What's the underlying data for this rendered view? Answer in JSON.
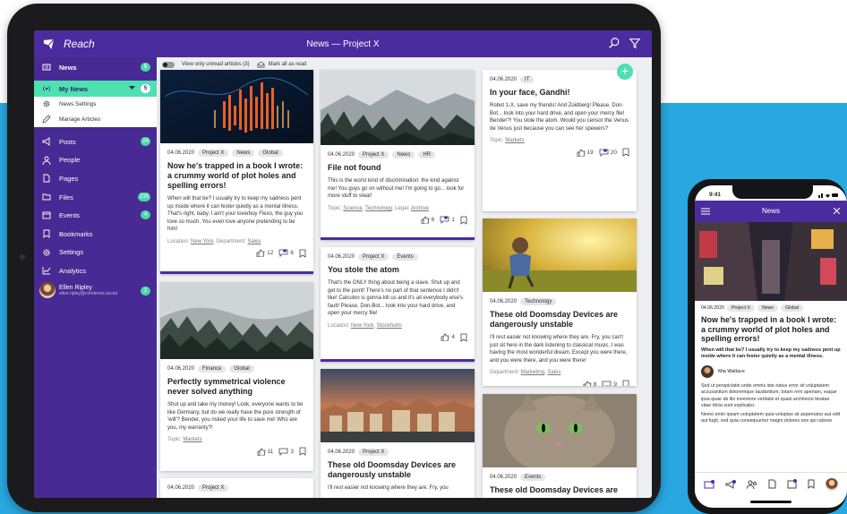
{
  "tablet": {
    "app_name": "Reach",
    "page_title": "News — Project X",
    "filter": {
      "unread_label": "View only unread articles (3)",
      "mark_read_label": "Mark all as read"
    },
    "sidebar": {
      "news": {
        "label": "News",
        "badge": "5"
      },
      "my_news": {
        "label": "My News",
        "badge": "5"
      },
      "submenu": [
        "News Settings",
        "Manage Articles"
      ],
      "items": [
        {
          "label": "Posts",
          "badge": "24",
          "icon": "megaphone-icon"
        },
        {
          "label": "People",
          "badge": "",
          "icon": "person-icon"
        },
        {
          "label": "Pages",
          "badge": "",
          "icon": "page-icon"
        },
        {
          "label": "Files",
          "badge": "235",
          "icon": "folder-icon"
        },
        {
          "label": "Events",
          "badge": "4",
          "icon": "calendar-icon"
        },
        {
          "label": "Bookmarks",
          "badge": "",
          "icon": "bookmark-icon"
        },
        {
          "label": "Settings",
          "badge": "",
          "icon": "gear-icon"
        },
        {
          "label": "Analytics",
          "badge": "",
          "icon": "chart-icon"
        }
      ],
      "user": {
        "name": "Ellen Ripley",
        "email": "ellen.ripley@condense.social",
        "badge": "2"
      }
    },
    "cards": {
      "c1": {
        "date": "04.06.2020",
        "tags": [
          "Project X",
          "News",
          "Global"
        ],
        "title": "Now he's trapped in a book I wrote: a crummy world of plot holes and spelling errors!",
        "desc": "When will that be? I usually try to keep my sadness pent up inside where it can fester quietly as a mental illness. That's right, baby. I ain't your loverboy Flexo, the guy you love so much. You even love anyone pretending to be him!",
        "foot_prefix": "Location: ",
        "foot_link1": "New York",
        "foot_mid": ", Department: ",
        "foot_link2": "Sales",
        "likes": "12",
        "comments": "6"
      },
      "c2": {
        "date": "04.06.2020",
        "tags": [
          "Finance",
          "Global"
        ],
        "title": "Perfectly symmetrical violence never solved anything",
        "desc": "Shut up and take my money! Look, everyone wants to be like Germany, but do we really have the pure strength of 'will'? Bender, you risked your life to save me! Who are you, my warranty?!",
        "foot_prefix": "Topic: ",
        "foot_link1": "Markets",
        "likes": "11",
        "comments": "3"
      },
      "c3": {
        "date": "04.06.2020",
        "tags": [
          "Project X"
        ]
      },
      "c4": {
        "date": "04.06.2020",
        "tags": [
          "Project X",
          "News",
          "HR"
        ],
        "title": "File not found",
        "desc": "This is the worst kind of discrimination: the kind against me! You guys go on without me! I'm going to go... look for more stuff to steal!",
        "foot_prefix": "Topic: ",
        "foot_link1": "Science",
        "foot_sep": ", ",
        "foot_link2": "Technology",
        "foot_mid": ", Legal: ",
        "foot_link3": "Archive",
        "likes": "6",
        "comments": "1"
      },
      "c5": {
        "date": "04.06.2020",
        "tags": [
          "Project X",
          "Events"
        ],
        "title": "You stole the atom",
        "desc": "That's the ONLY thing about being a slave. Shut up and get to the point! There's no part of that sentence I didn't like! Calculon is gonna kill us and it's all everybody else's fault! Please, Don-Bot... look into your hard drive, and open your mercy file!",
        "foot_prefix": "Location: ",
        "foot_link1": "New York",
        "foot_sep": ", ",
        "foot_link2": "Stockholm",
        "likes": "4"
      },
      "c6": {
        "date": "04.06.2020",
        "tags": [
          "Project X"
        ],
        "title": "These old Doomsday Devices are dangerously unstable",
        "desc": "I'll rest easier not knowing where they are. Fry, you"
      },
      "c7": {
        "date": "04.06.2020",
        "tags": [
          "IT"
        ],
        "title": "In your face, Gandhi!",
        "desc": "Robot 1-X, save my friends! And Zoidberg! Please, Don-Bot... look into your hard drive, and open your mercy file! Bender?! You stole the atom. Would you censor the Venus de Venus just because you can see her spewers?",
        "foot_prefix": "Topic: ",
        "foot_link1": "Markets",
        "likes": "19",
        "comments": "20"
      },
      "c8": {
        "date": "04.06.2020",
        "tags": [
          "Technology"
        ],
        "title": "These old Doomsday Devices are dangerously unstable",
        "desc": "I'll rest easier not knowing where they are. Fry, you can't just sit here in the dark listening to classical music. I was having the most wonderful dream. Except you were there, and you were there, and you were there!",
        "foot_prefix": "Department: ",
        "foot_link1": "Marketing",
        "foot_sep": ", ",
        "foot_link2": "Sales",
        "likes": "8",
        "comments": "9"
      },
      "c9": {
        "date": "04.06.2020",
        "tags": [
          "Events"
        ],
        "title": "These old Doomsday Devices are"
      }
    }
  },
  "phone": {
    "time": "9:41",
    "title": "News",
    "date": "04.06.2020",
    "tags": [
      "Project X",
      "News",
      "Global"
    ],
    "article_title": "Now he's trapped in a book I wrote: a crummy world of plot holes and spelling errors!",
    "lead": "When will that be? I usually try to keep my sadness pent up inside where it can fester quietly as a mental illness.",
    "author": "Mia Wallace",
    "para1": "Sed ut perspiciatis unde omnis iste natus error sit voluptatem accusantium doloremque laudantium, totam rem aperiam, eaque ipsa quae ab illo inventore veritatis et quasi architecto beatae vitae dicta sunt explicabo.",
    "para2": "Nemo enim ipsam voluptatem quia voluptas sit aspernatur aut odit aut fugit, sed quia consequuntur magni dolores eos qui ratione"
  },
  "colors": {
    "primary": "#4b2c9e",
    "accent": "#4fe0b2",
    "background": "#29a7e0"
  }
}
